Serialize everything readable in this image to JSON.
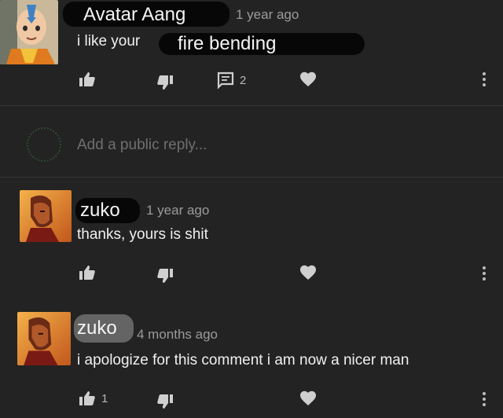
{
  "comment": {
    "author": "Avatar Aang",
    "time": "1 year ago",
    "text_plain": "i like your",
    "text_highlight": "fire bending",
    "reply_count": "2"
  },
  "reply_box": {
    "placeholder": "Add a public reply..."
  },
  "replies": [
    {
      "author": "zuko",
      "time": "1 year ago",
      "text": "thanks, yours is shit",
      "like_count": ""
    },
    {
      "author": "zuko",
      "time": "4 months ago",
      "text": "i apologize for this comment i am now a nicer man",
      "like_count": "1"
    }
  ],
  "icons": {
    "like": "thumbs-up-icon",
    "dislike": "thumbs-down-icon",
    "reply": "comment-icon",
    "heart": "heart-icon",
    "more": "more-vertical-icon"
  },
  "colors": {
    "background": "#232323",
    "icon": "#c9c9c9",
    "muted_text": "#9a9a9a"
  }
}
